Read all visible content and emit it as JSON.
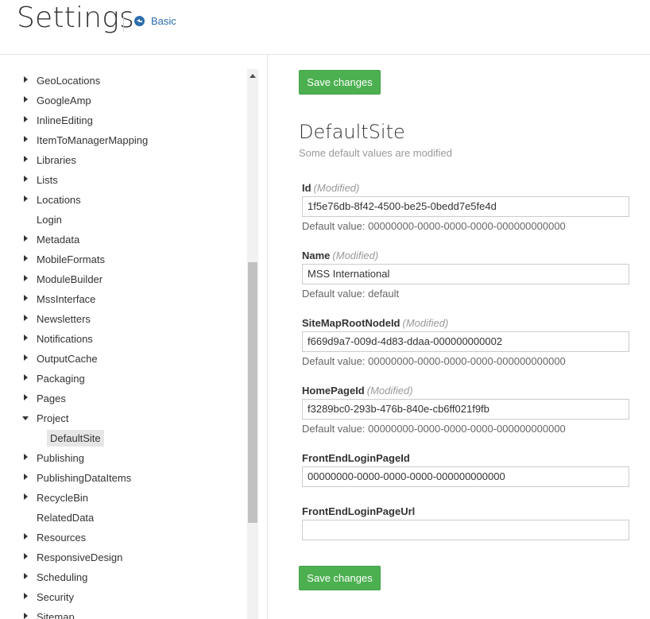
{
  "header": {
    "title": "Settings",
    "back_label": "Basic"
  },
  "sidebar": {
    "items": [
      {
        "label": "GeoLocations",
        "arrow": "right"
      },
      {
        "label": "GoogleAmp",
        "arrow": "right"
      },
      {
        "label": "InlineEditing",
        "arrow": "right"
      },
      {
        "label": "ItemToManagerMapping",
        "arrow": "right"
      },
      {
        "label": "Libraries",
        "arrow": "right"
      },
      {
        "label": "Lists",
        "arrow": "right"
      },
      {
        "label": "Locations",
        "arrow": "right"
      },
      {
        "label": "Login",
        "arrow": "none"
      },
      {
        "label": "Metadata",
        "arrow": "right"
      },
      {
        "label": "MobileFormats",
        "arrow": "right"
      },
      {
        "label": "ModuleBuilder",
        "arrow": "right"
      },
      {
        "label": "MssInterface",
        "arrow": "right"
      },
      {
        "label": "Newsletters",
        "arrow": "right"
      },
      {
        "label": "Notifications",
        "arrow": "right"
      },
      {
        "label": "OutputCache",
        "arrow": "right"
      },
      {
        "label": "Packaging",
        "arrow": "right"
      },
      {
        "label": "Pages",
        "arrow": "right"
      },
      {
        "label": "Project",
        "arrow": "down"
      },
      {
        "label": "DefaultSite",
        "arrow": "child"
      },
      {
        "label": "Publishing",
        "arrow": "right"
      },
      {
        "label": "PublishingDataItems",
        "arrow": "right"
      },
      {
        "label": "RecycleBin",
        "arrow": "right"
      },
      {
        "label": "RelatedData",
        "arrow": "none"
      },
      {
        "label": "Resources",
        "arrow": "right"
      },
      {
        "label": "ResponsiveDesign",
        "arrow": "right"
      },
      {
        "label": "Scheduling",
        "arrow": "right"
      },
      {
        "label": "Security",
        "arrow": "right"
      },
      {
        "label": "Sitemap",
        "arrow": "right"
      }
    ]
  },
  "main": {
    "save_label": "Save changes",
    "section_title": "DefaultSite",
    "section_subtitle": "Some default values are modified",
    "modified_label": "(Modified)",
    "fields": [
      {
        "label": "Id",
        "modified": true,
        "value": "1f5e76db-8f42-4500-be25-0bedd7e5fe4d",
        "default": "Default value: 00000000-0000-0000-0000-000000000000"
      },
      {
        "label": "Name",
        "modified": true,
        "value": "MSS International",
        "default": "Default value: default"
      },
      {
        "label": "SiteMapRootNodeId",
        "modified": true,
        "value": "f669d9a7-009d-4d83-ddaa-000000000002",
        "default": "Default value: 00000000-0000-0000-0000-000000000000"
      },
      {
        "label": "HomePageId",
        "modified": true,
        "value": "f3289bc0-293b-476b-840e-cb6ff021f9fb",
        "default": "Default value: 00000000-0000-0000-0000-000000000000"
      },
      {
        "label": "FrontEndLoginPageId",
        "modified": false,
        "value": "00000000-0000-0000-0000-000000000000",
        "default": ""
      },
      {
        "label": "FrontEndLoginPageUrl",
        "modified": false,
        "value": "",
        "default": ""
      }
    ]
  }
}
